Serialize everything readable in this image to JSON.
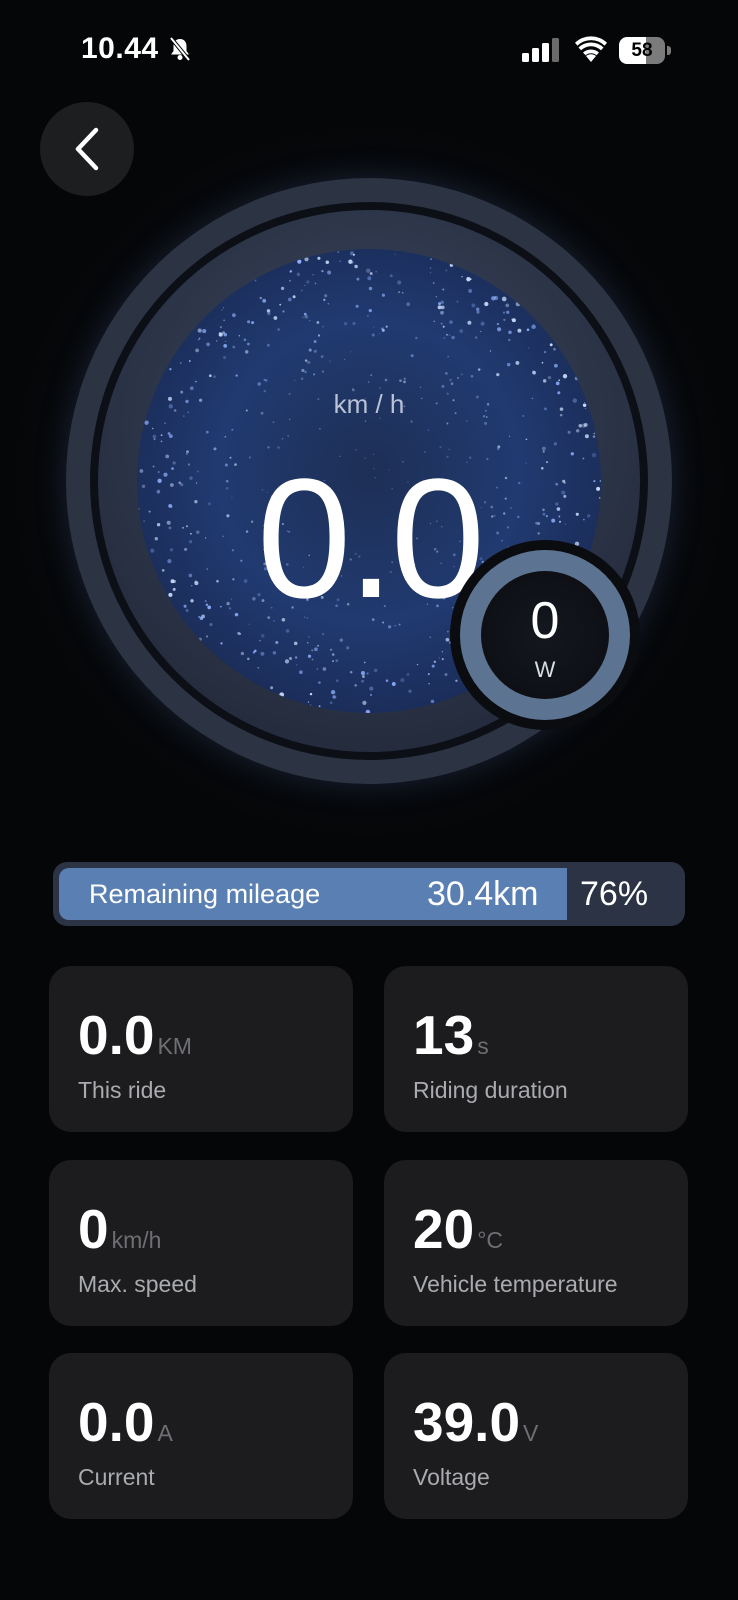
{
  "status_bar": {
    "time": "10.44",
    "battery_level": "58",
    "icons": [
      "bell-slash-icon",
      "cellular-signal-icon",
      "wifi-icon",
      "battery-icon"
    ]
  },
  "back_button": {
    "icon": "chevron-left-icon"
  },
  "speedometer": {
    "unit": "km / h",
    "value": "0.0"
  },
  "power": {
    "value": "0",
    "unit": "W"
  },
  "mileage": {
    "label": "Remaining mileage",
    "distance": "30.4km",
    "percent": "76%",
    "fill_fraction": 0.82
  },
  "stats": [
    {
      "value": "0.0",
      "unit": "KM",
      "label": "This ride"
    },
    {
      "value": "13",
      "unit": "s",
      "label": "Riding duration"
    },
    {
      "value": "0",
      "unit": "km/h",
      "label": "Max. speed"
    },
    {
      "value": "20",
      "unit": "°C",
      "label": "Vehicle temperature"
    },
    {
      "value": "0.0",
      "unit": "A",
      "label": "Current"
    },
    {
      "value": "39.0",
      "unit": "V",
      "label": "Voltage"
    }
  ],
  "colors": {
    "background": "#050607",
    "card": "#1c1c1e",
    "accent_blue": "#5a7fb2",
    "mileage_track": "#2b3344"
  }
}
